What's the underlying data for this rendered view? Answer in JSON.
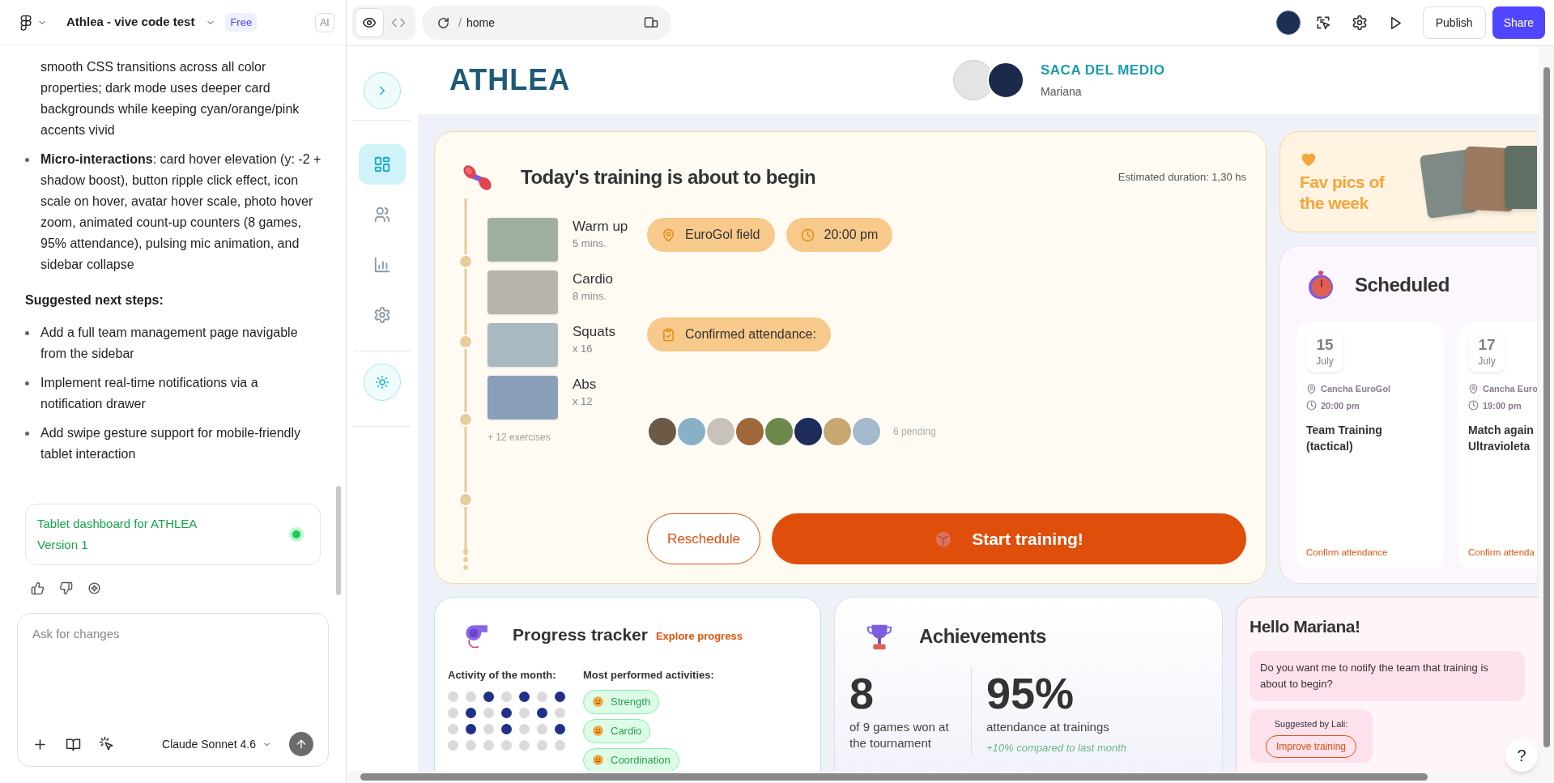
{
  "editor": {
    "title": "Athlea - vive code test",
    "plan": "Free",
    "ai_label": "AI"
  },
  "chat": {
    "items": [
      {
        "kind": "continuation",
        "text": "smooth CSS transitions across all color properties; dark mode uses deeper card backgrounds while keeping cyan/orange/pink accents vivid"
      },
      {
        "kind": "bullet",
        "text": "**Micro-interactions**: card hover elevation (y: -2 + shadow boost), button ripple click effect, icon scale on hover, avatar hover scale, photo hover zoom, animated count-up counters (8 games, 95% attendance), pulsing mic animation, and sidebar collapse"
      },
      {
        "kind": "heading",
        "text": "**Suggested next steps:**"
      },
      {
        "kind": "bullet",
        "text": "Add a full team management page navigable from the sidebar"
      },
      {
        "kind": "bullet",
        "text": "Implement real-time notifications via a notification drawer"
      },
      {
        "kind": "bullet",
        "text": "Add swipe gesture support for mobile-friendly tablet interaction"
      }
    ],
    "version_card": {
      "title": "Tablet dashboard for ATHLEA",
      "version": "Version 1"
    },
    "input": {
      "placeholder": "Ask for changes"
    },
    "model": "Claude Sonnet 4.6"
  },
  "toolbar": {
    "views": [
      {
        "selected": true
      },
      {
        "selected": false
      }
    ],
    "path_separator": "/",
    "path": "home",
    "publish": "Publish",
    "share": "Share"
  },
  "app": {
    "logo": "ATHLEA",
    "team": "SACA DEL MEDIO",
    "user": "Mariana",
    "sidebar": {
      "items": [
        {
          "selected": true
        },
        {
          "selected": false
        },
        {
          "selected": false
        },
        {
          "selected": false
        }
      ]
    },
    "training": {
      "title": "Today's training is about to begin",
      "duration": "Estimated duration: 1,30 hs",
      "exercises": [
        {
          "name": "Warm up",
          "detail": "5 mins."
        },
        {
          "name": "Cardio",
          "detail": "8 mins."
        },
        {
          "name": "Squats",
          "detail": "x 16"
        },
        {
          "name": "Abs",
          "detail": "x 12"
        }
      ],
      "more": "+ 12 exercises",
      "chips": [
        {
          "kind": "location",
          "text": "EuroGol field"
        },
        {
          "kind": "time",
          "text": "20:00 pm"
        }
      ],
      "attendance": "Confirmed attendance:",
      "pending": "6 pending",
      "reschedule": "Reschedule",
      "start": "Start training!"
    },
    "fav_pics": {
      "title": "Fav pics of the week"
    },
    "scheduled": {
      "title": "Scheduled",
      "events": [
        {
          "day": "15",
          "month": "July",
          "place": "Cancha EuroGol",
          "time": "20:00 pm",
          "title": "Team Training\n(tactical)",
          "action": "Confirm attendance"
        },
        {
          "day": "17",
          "month": "July",
          "place": "Cancha Euro",
          "time": "19:00 pm",
          "title": "Match again\nUltravioleta",
          "action": "Confirm attenda"
        }
      ]
    },
    "progress": {
      "title": "Progress tracker",
      "link": "Explore progress",
      "activity_label": "Activity of the month:",
      "activity_days": [
        {
          "active": false
        },
        {
          "active": false
        },
        {
          "active": true
        },
        {
          "active": false
        },
        {
          "active": true
        },
        {
          "active": false
        },
        {
          "active": true
        },
        {
          "active": false
        },
        {
          "active": true
        },
        {
          "active": false
        },
        {
          "active": true
        },
        {
          "active": false
        },
        {
          "active": true
        },
        {
          "active": false
        },
        {
          "active": false
        },
        {
          "active": true
        },
        {
          "active": false
        },
        {
          "active": true
        },
        {
          "active": false
        },
        {
          "active": false
        },
        {
          "active": true
        },
        {
          "active": false
        },
        {
          "active": false
        },
        {
          "active": false
        },
        {
          "active": false
        },
        {
          "active": false
        },
        {
          "active": false
        },
        {
          "active": false
        }
      ],
      "activities_label": "Most performed activities:",
      "activities": [
        "Strength",
        "Cardio",
        "Coordination"
      ]
    },
    "achievements": {
      "title": "Achievements",
      "stats": [
        {
          "value": "8",
          "label": "of 9 games won at the tournament"
        },
        {
          "value": "95%",
          "label": "attendance at trainings"
        }
      ],
      "note": "+10% compared to last month"
    },
    "assistant": {
      "greeting": "Hello Mariana!",
      "message": "Do you want me to notify the team that training is about to begin?",
      "suggested_by": "Suggested by Lali:",
      "suggestion": "Improve training"
    },
    "help_label": "?"
  }
}
